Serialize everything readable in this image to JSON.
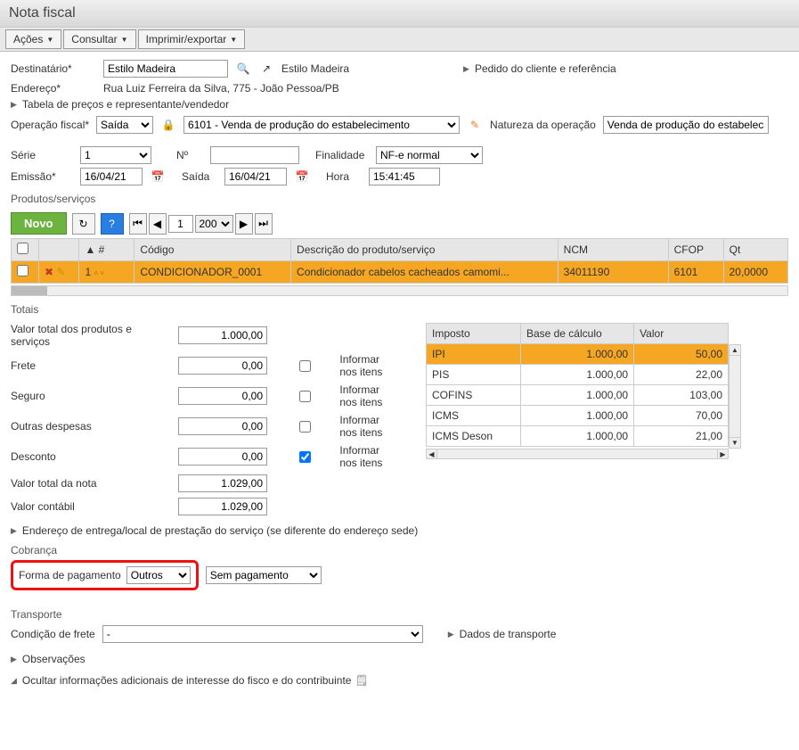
{
  "window_title": "Nota fiscal",
  "menu": {
    "acoes": "Ações",
    "consultar": "Consultar",
    "imprimir": "Imprimir/exportar"
  },
  "dest": {
    "label": "Destinatário*",
    "value": "Estilo Madeira",
    "link_text": "Estilo Madeira",
    "pedido_link": "Pedido do cliente e referência"
  },
  "endereco": {
    "label": "Endereço*",
    "value": "Rua Luiz Ferreira da Silva, 775 - João Pessoa/PB"
  },
  "tabela_precos_link": "Tabela de preços e representante/vendedor",
  "opfiscal": {
    "label": "Operação fiscal*",
    "select1": "Saída",
    "cfop": "6101 - Venda de produção do estabelecimento",
    "natureza_label": "Natureza da operação",
    "natureza_value": "Venda de produção do estabelecim"
  },
  "serie": {
    "label": "Série",
    "value": "1",
    "numero_label": "Nº",
    "numero_value": "",
    "finalidade_label": "Finalidade",
    "finalidade_value": "NF-e normal"
  },
  "emissao": {
    "label": "Emissão*",
    "value": "16/04/21",
    "saida_label": "Saída",
    "saida_value": "16/04/21",
    "hora_label": "Hora",
    "hora_value": "15:41:45"
  },
  "produtos_label": "Produtos/serviços",
  "grid_toolbar": {
    "novo": "Novo",
    "page": "1",
    "page_size": "200"
  },
  "grid_headers": {
    "idx": "#",
    "codigo": "Código",
    "descricao": "Descrição do produto/serviço",
    "ncm": "NCM",
    "cfop": "CFOP",
    "qt": "Qt"
  },
  "grid_row": {
    "idx": "1",
    "codigo": "CONDICIONADOR_0001",
    "descricao": "Condicionador cabelos cacheados camomi...",
    "ncm": "34011190",
    "cfop": "6101",
    "qt": "20,0000"
  },
  "totais": {
    "label": "Totais",
    "valor_produtos_label": "Valor total dos produtos e serviços",
    "valor_produtos": "1.000,00",
    "frete_label": "Frete",
    "frete": "0,00",
    "seguro_label": "Seguro",
    "seguro": "0,00",
    "outras_label": "Outras despesas",
    "outras": "0,00",
    "desconto_label": "Desconto",
    "desconto": "0,00",
    "valor_nota_label": "Valor total da nota",
    "valor_nota": "1.029,00",
    "valor_contabil_label": "Valor contábil",
    "valor_contabil": "1.029,00",
    "informar_label": "Informar nos itens"
  },
  "tax_headers": {
    "imposto": "Imposto",
    "base": "Base de cálculo",
    "valor": "Valor"
  },
  "tax_rows": [
    {
      "imposto": "IPI",
      "base": "1.000,00",
      "valor": "50,00",
      "hl": true
    },
    {
      "imposto": "PIS",
      "base": "1.000,00",
      "valor": "22,00"
    },
    {
      "imposto": "COFINS",
      "base": "1.000,00",
      "valor": "103,00"
    },
    {
      "imposto": "ICMS",
      "base": "1.000,00",
      "valor": "70,00"
    },
    {
      "imposto": "ICMS Deson",
      "base": "1.000,00",
      "valor": "21,00"
    }
  ],
  "endereco_entrega_link": "Endereço de entrega/local de prestação do serviço (se diferente do endereço sede)",
  "cobranca": {
    "label": "Cobrança",
    "forma_label": "Forma de pagamento",
    "forma_value": "Outros",
    "tipo_value": "Sem pagamento"
  },
  "transporte": {
    "label": "Transporte",
    "cond_label": "Condição de frete",
    "cond_value": "-",
    "dados_link": "Dados de transporte"
  },
  "observacoes_link": "Observações",
  "ocultar_link": "Ocultar informações adicionais de interesse do fisco e do contribuinte"
}
